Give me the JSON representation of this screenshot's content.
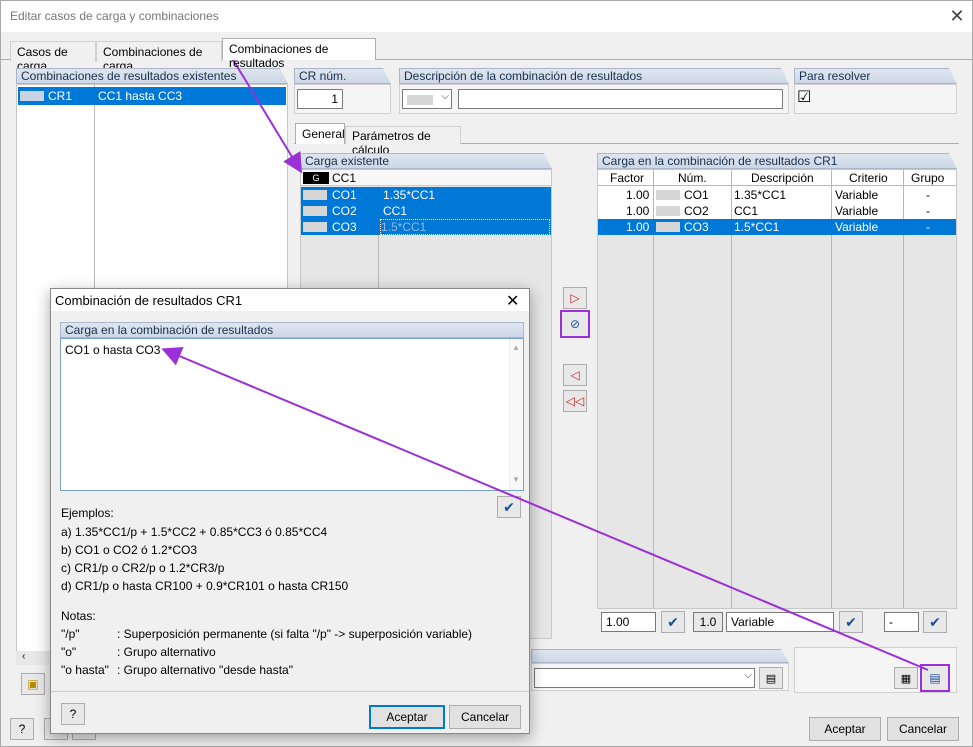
{
  "window": {
    "title": "Editar casos de carga y combinaciones",
    "close": "✕"
  },
  "tabs": [
    "Casos de carga",
    "Combinaciones de carga",
    "Combinaciones de resultados"
  ],
  "left_panel": {
    "header": "Combinaciones de resultados existentes",
    "rows": [
      {
        "num": "CR1",
        "desc": "CC1 hasta CC3"
      }
    ]
  },
  "cr_num": {
    "label": "CR núm.",
    "value": "1"
  },
  "desc_combo": {
    "label": "Descripción de la combinación de resultados",
    "value": ""
  },
  "para_resolver": {
    "label": "Para resolver",
    "checked": "☑"
  },
  "subtabs": [
    "General",
    "Parámetros de cálculo"
  ],
  "carga_existente": {
    "header": "Carga existente",
    "rows": [
      {
        "badge": "G",
        "num": "CC1",
        "desc": ""
      },
      {
        "num": "CO1",
        "desc": "1.35*CC1"
      },
      {
        "num": "CO2",
        "desc": "CC1"
      },
      {
        "num": "CO3",
        "desc": "1.5*CC1"
      }
    ]
  },
  "carga_combinacion": {
    "header": "Carga en la combinación de resultados CR1",
    "columns": [
      "Factor",
      "Núm.",
      "Descripción",
      "Criterio",
      "Grupo"
    ],
    "rows": [
      {
        "factor": "1.00",
        "num": "CO1",
        "desc": "1.35*CC1",
        "criterio": "Variable",
        "grupo": "-"
      },
      {
        "factor": "1.00",
        "num": "CO2",
        "desc": "CC1",
        "criterio": "Variable",
        "grupo": "-"
      },
      {
        "factor": "1.00",
        "num": "CO3",
        "desc": "1.5*CC1",
        "criterio": "Variable",
        "grupo": "-"
      }
    ],
    "bottom": {
      "factor": "1.00",
      "num": "1.0",
      "criterio": "Variable",
      "grupo": "-"
    }
  },
  "dialog": {
    "title": "Combinación de resultados CR1",
    "section": "Carga en la combinación de resultados",
    "text": "CO1 o hasta CO3",
    "examples_title": "Ejemplos:",
    "examples": [
      "a)  1.35*CC1/p + 1.5*CC2 + 0.85*CC3 ó 0.85*CC4",
      "b)  CO1 o CO2 ó 1.2*CO3",
      "c)  CR1/p o CR2/p o 1.2*CR3/p",
      "d)  CR1/p o hasta CR100 + 0.9*CR101 o hasta CR150"
    ],
    "notes_title": "Notas:",
    "notes": [
      {
        "k": "\"/p\"",
        "v": ": Superposición permanente (si falta \"/p\" -> superposición variable)"
      },
      {
        "k": "\"o\"",
        "v": ": Grupo alternativo"
      },
      {
        "k": "\"o hasta\"",
        "v": ": Grupo alternativo \"desde hasta\""
      }
    ],
    "ok": "Aceptar",
    "cancel": "Cancelar"
  },
  "footer": {
    "ok": "Aceptar",
    "cancel": "Cancelar"
  },
  "highlight_color": "#9b30d9",
  "selection_color": "#0078d7"
}
